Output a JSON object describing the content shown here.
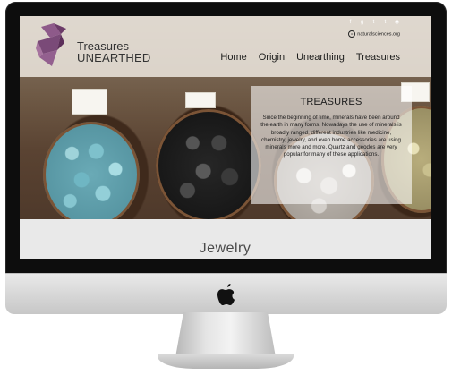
{
  "site": {
    "logo_line1": "Treasures",
    "logo_line2": "UNEARTHED",
    "website": "naturalsciences.org"
  },
  "social_icons": [
    "facebook-icon",
    "google-plus-icon",
    "twitter-icon",
    "tumblr-icon",
    "rss-icon"
  ],
  "nav": {
    "items": [
      {
        "label": "Home"
      },
      {
        "label": "Origin"
      },
      {
        "label": "Unearthing"
      },
      {
        "label": "Treasures"
      }
    ]
  },
  "panel": {
    "title": "TREASURES",
    "body": "Since the beginning of time, minerals have been around the earth in many forms. Nowadays the use of minerals is broadly ranged, different industries like medicine, chemistry, jewelry, and even home accessories are using minerals more and more. Quartz and geodes are very popular for many of these applications."
  },
  "section": {
    "heading": "Jewelry"
  },
  "colors": {
    "logo_purple": "#7a4a78",
    "header_bg": "#ece6de",
    "bezel": "#0d0d0d"
  }
}
